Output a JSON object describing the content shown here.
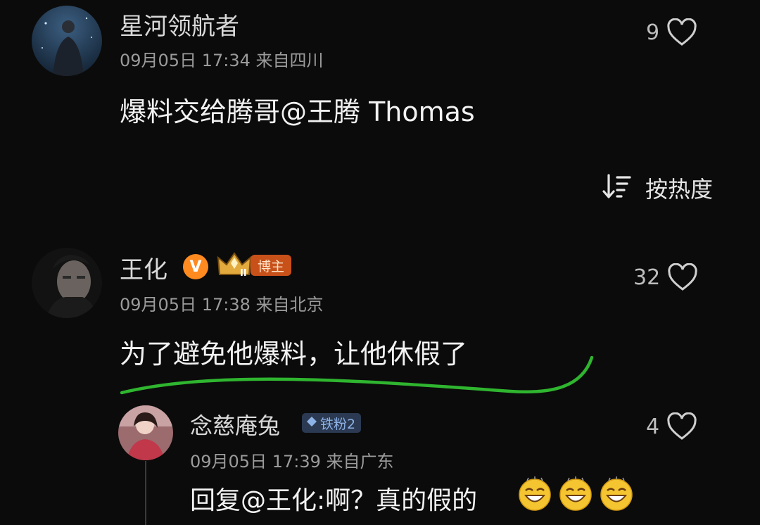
{
  "comments": [
    {
      "username": "星河领航者",
      "timestamp": "09月05日 17:34 来自四川",
      "text": "爆料交给腾哥@王腾 Thomas",
      "likes": "9",
      "avatar": "avatar-space-man-icon"
    }
  ],
  "sort": {
    "label": "按热度",
    "icon": "sort-descending-icon"
  },
  "main_comment": {
    "username": "王化",
    "verified_badge": "V",
    "crown_level": "II",
    "role_tag": "博主",
    "timestamp": "09月05日 17:38 来自北京",
    "text": "为了避免他爆料，让他休假了",
    "likes": "32",
    "underline_color": "#2fb52f"
  },
  "reply": {
    "username": "念慈庵兔",
    "fan_badge": "铁粉2",
    "timestamp": "09月05日 17:39 来自广东",
    "text": "回复@王化:啊？真的假的",
    "emoji": [
      "grinning-face-emoji",
      "grinning-face-emoji",
      "grinning-face-emoji"
    ],
    "likes": "4"
  },
  "colors": {
    "background": "#0b0b0b",
    "role_tag": "#c8511a",
    "verified": "#ff8a1f"
  }
}
